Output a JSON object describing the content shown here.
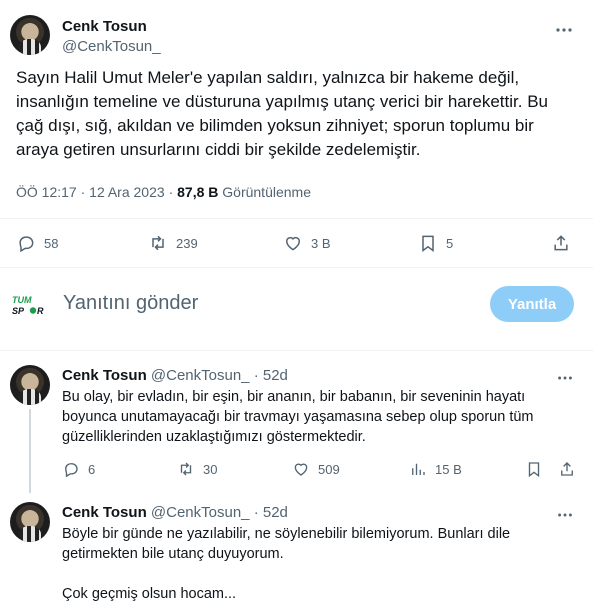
{
  "tweet": {
    "author_name": "Cenk Tosun",
    "author_handle": "@CenkTosun_",
    "text": "Sayın Halil Umut Meler'e yapılan saldırı, yalnızca bir hakeme değil, insanlığın temeline ve düsturuna yapılmış utanç verici bir harekettir. Bu çağ dışı, sığ, akıldan ve bilimden yoksun zihniyet; sporun toplumu bir araya getiren unsurlarını ciddi bir şekilde zedelemiştir.",
    "time": "ÖÖ 12:17",
    "separator": "·",
    "date": "12 Ara 2023",
    "views_count": "87,8 B",
    "views_label": "Görüntülenme",
    "replies": "58",
    "retweets": "239",
    "likes": "3 B",
    "bookmarks": "5"
  },
  "reply_box": {
    "placeholder": "Yanıtını gönder",
    "button_label": "Yanıtla",
    "logo_text": "TUMSPOR"
  },
  "comments": [
    {
      "name": "Cenk Tosun",
      "handle": "@CenkTosun_",
      "dot": "·",
      "age": "52d",
      "text": "Bu olay, bir evladın, bir eşin, bir ananın, bir babanın, bir seveninin hayatı boyunca unutamayacağı bir travmayı yaşamasına sebep olup sporun tüm güzelliklerinden uzaklaştığımızı göstermektedir.",
      "replies": "6",
      "retweets": "30",
      "likes": "509",
      "views": "15 B"
    },
    {
      "name": "Cenk Tosun",
      "handle": "@CenkTosun_",
      "dot": "·",
      "age": "52d",
      "text": "Böyle bir günde ne yazılabilir, ne söylenebilir bilemiyorum. Bunları dile getirmekten bile utanç duyuyorum.",
      "text2": "Çok geçmiş olsun hocam..."
    }
  ],
  "colors": {
    "text_primary": "#0f1419",
    "text_secondary": "#536471",
    "reply_button": "#8ecdf8",
    "divider": "#eff3f4",
    "logo_green": "#1a9e4b"
  },
  "icons": [
    "more-icon",
    "reply-icon",
    "retweet-icon",
    "like-icon",
    "bookmark-icon",
    "share-icon",
    "views-icon"
  ]
}
